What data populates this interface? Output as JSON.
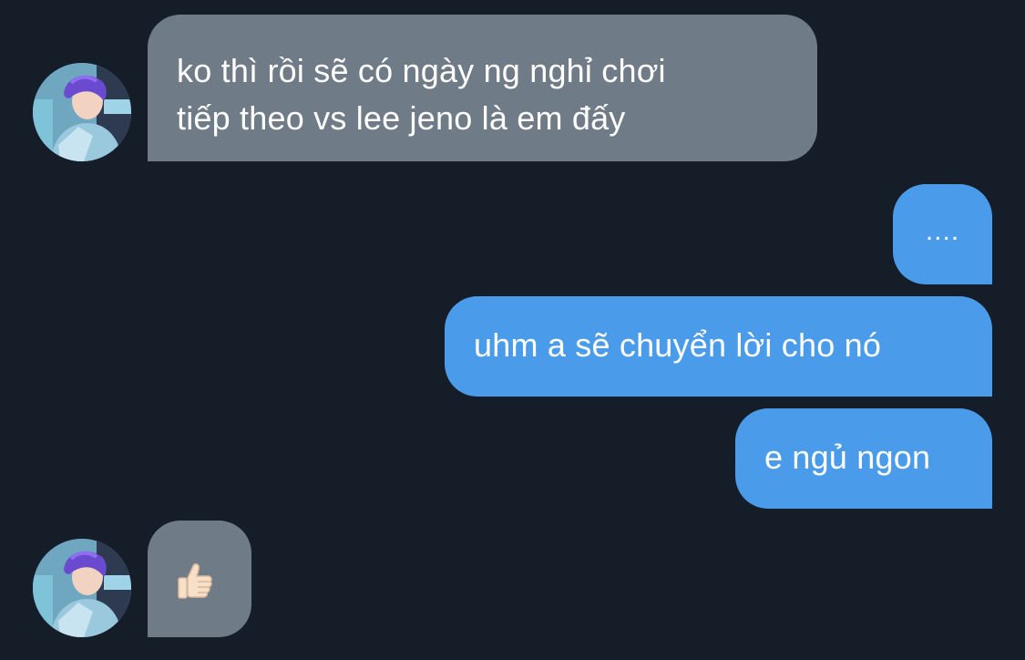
{
  "messages": [
    {
      "direction": "incoming",
      "lines": [
        "ko thì rồi sẽ có ngày ng nghỉ chơi",
        "tiếp theo vs lee jeno là em đấy"
      ]
    },
    {
      "direction": "outgoing",
      "text": "...."
    },
    {
      "direction": "outgoing",
      "text": "uhm a sẽ chuyển lời cho nó"
    },
    {
      "direction": "outgoing",
      "text": "e ngủ ngon"
    },
    {
      "direction": "incoming",
      "icon": "thumbs-up-icon"
    }
  ],
  "contact": {
    "avatar": "avatar-photo"
  },
  "colors": {
    "background": "#151d28",
    "incoming_bubble": "#6f7b87",
    "outgoing_bubble": "#4a9bea",
    "text": "#ffffff"
  }
}
